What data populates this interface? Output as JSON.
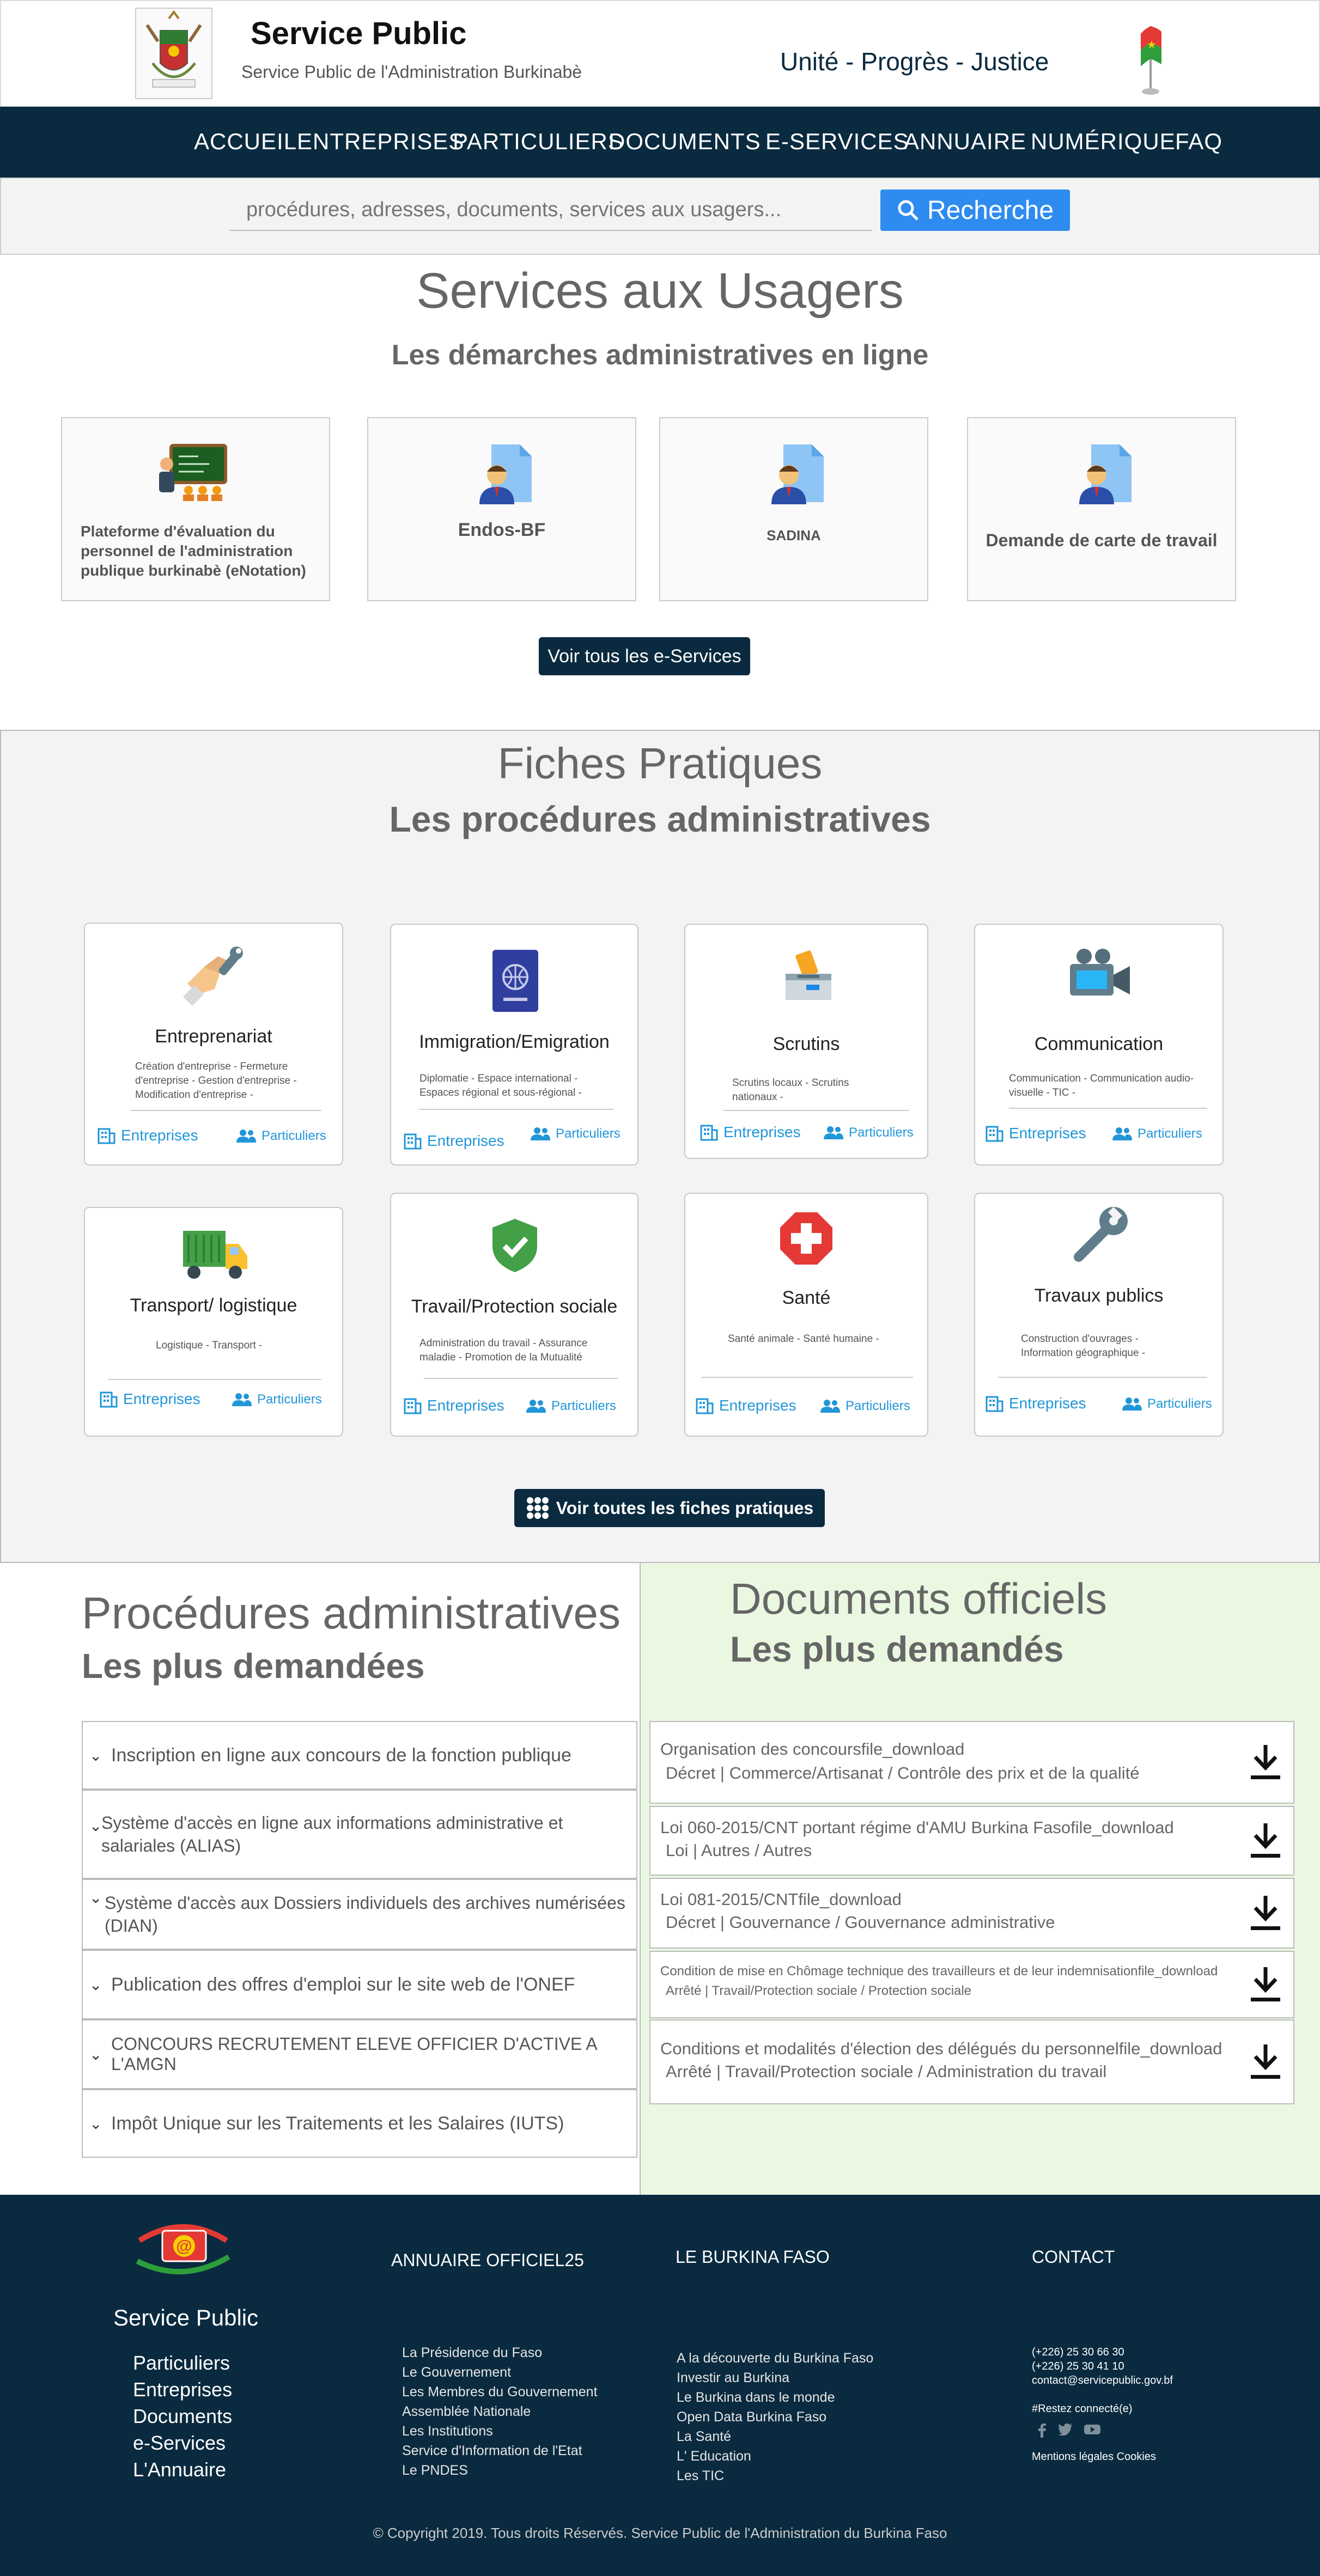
{
  "header": {
    "site_title": "Service Public",
    "site_subtitle": "Service Public de l'Administration Burkinabè",
    "motto": "Unité - Progrès - Justice"
  },
  "nav": {
    "items": [
      "ACCUEIL",
      "ENTREPRISES",
      "PARTICULIERS",
      "DOCUMENTS",
      "E-SERVICES",
      "ANNUAIRE",
      "NUMÉRIQUE",
      "FAQ"
    ]
  },
  "search": {
    "placeholder": "procédures, adresses, documents, services aux usagers...",
    "button_label": "Recherche"
  },
  "eservices": {
    "title": "Services aux Usagers",
    "subtitle": "Les démarches administratives en ligne",
    "items": [
      {
        "label": "Plateforme d'évaluation du personnel de l'administration publique burkinabè (eNotation)",
        "icon": "teacher-board-icon"
      },
      {
        "label": "Endos-BF",
        "icon": "document-person-icon"
      },
      {
        "label": "SADINA",
        "icon": "document-person-icon"
      },
      {
        "label": "Demande de carte de travail",
        "icon": "document-person-icon"
      }
    ],
    "all_button": "Voir tous les e-Services"
  },
  "fiches": {
    "title": "Fiches Pratiques",
    "subtitle": "Les procédures administratives",
    "entreprises_label": "Entreprises",
    "particuliers_label": "Particuliers",
    "cards": [
      {
        "title": "Entreprenariat",
        "desc": "Création d'entreprise - Fermeture d'entreprise - Gestion d'entreprise - Modification d'entreprise -",
        "icon": "handshake-icon"
      },
      {
        "title": "Immigration/Emigration",
        "desc": "Diplomatie - Espace international - Espaces régional et sous-régional -",
        "icon": "passport-icon"
      },
      {
        "title": "Scrutins",
        "desc": "Scrutins locaux - Scrutins nationaux -",
        "icon": "ballot-box-icon"
      },
      {
        "title": "Communication",
        "desc": "Communication - Communication audio-visuelle - TIC -",
        "icon": "video-camera-icon"
      },
      {
        "title": "Transport/ logistique",
        "desc": "Logistique - Transport -",
        "icon": "truck-icon"
      },
      {
        "title": "Travail/Protection sociale",
        "desc": "Administration du travail - Assurance maladie - Promotion de la Mutualité",
        "icon": "shield-check-icon"
      },
      {
        "title": "Santé",
        "desc": "Santé animale - Santé humaine -",
        "icon": "medical-cross-icon"
      },
      {
        "title": "Travaux publics",
        "desc": "Construction d'ouvrages - Information géographique -",
        "icon": "wrench-icon"
      }
    ],
    "all_button": "Voir toutes les fiches pratiques"
  },
  "procedures": {
    "title": "Procédures administratives",
    "subtitle": "Les plus demandées",
    "items": [
      "Inscription en ligne aux concours de la fonction publique",
      "Système d'accès en ligne aux informations administrative et salariales (ALIAS)",
      "Système d'accès aux Dossiers individuels des archives numérisées (DIAN)",
      "Publication des offres d'emploi sur le site web de l'ONEF",
      "CONCOURS RECRUTEMENT ELEVE OFFICIER D'ACTIVE A L'AMGN",
      "Impôt Unique sur les Traitements et les Salaires (IUTS)"
    ]
  },
  "documents": {
    "title": "Documents officiels",
    "subtitle": "Les plus demandés",
    "items": [
      {
        "title": "Organisation des concoursfile_download",
        "meta": "Décret | Commerce/Artisanat / Contrôle des prix et de la qualité"
      },
      {
        "title": "Loi 060-2015/CNT portant régime d'AMU Burkina Fasofile_download",
        "meta": "Loi | Autres / Autres"
      },
      {
        "title": "Loi 081-2015/CNTfile_download",
        "meta": "Décret | Gouvernance / Gouvernance administrative"
      },
      {
        "title": "Condition de mise en Chômage technique des travailleurs et de leur indemnisationfile_download",
        "meta": "Arrêté | Travail/Protection sociale / Protection sociale"
      },
      {
        "title": "Conditions et modalités d'élection des délégués du personnelfile_download",
        "meta": "Arrêté | Travail/Protection sociale / Administration du travail"
      }
    ]
  },
  "footer": {
    "brand": "Service Public",
    "brand_links": [
      "Particuliers",
      "Entreprises",
      "Documents",
      "e-Services",
      "L'Annuaire"
    ],
    "col1_title": "ANNUAIRE OFFICIEL25",
    "col1_links": [
      "La Présidence du Faso",
      "Le Gouvernement",
      "Les Membres du Gouvernement",
      "Assemblée Nationale",
      "Les Institutions",
      "Service d'Information de l'Etat",
      "Le PNDES"
    ],
    "col2_title": "LE BURKINA FASO",
    "col2_links": [
      "A la découverte du Burkina Faso",
      "Investir au Burkina",
      "Le Burkina dans le monde",
      "Open Data Burkina Faso",
      "La Santé",
      "L' Education",
      "Les TIC"
    ],
    "col3_title": "CONTACT",
    "contact": [
      "(+226) 25 30 66 30",
      "(+226) 25 30 41 10",
      "contact@servicepublic.gov.bf"
    ],
    "stay_connected": "#Restez connecté(e)",
    "legal": "Mentions légales Cookies",
    "copyright": "© Copyright 2019. Tous droits Réservés. Service Public de l'Administration du Burkina Faso"
  },
  "colors": {
    "navy": "#0a2a3f",
    "link_blue": "#2196d8",
    "search_blue": "#2e8cf0",
    "docs_bg": "#eaf8e1"
  }
}
